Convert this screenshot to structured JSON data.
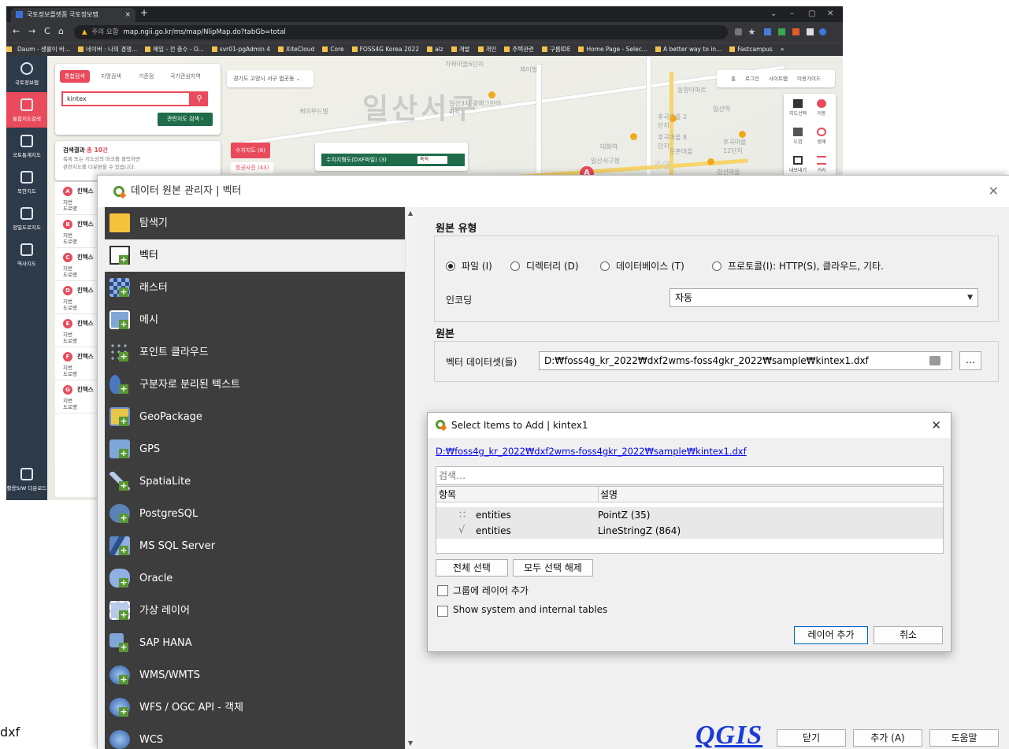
{
  "browser": {
    "tab_title": "국토정보플랫폼 국토정보맵",
    "tab_close": "×",
    "new_tab": "+",
    "window_controls": [
      "⌄",
      "–",
      "▢",
      "✕"
    ],
    "nav": [
      "←",
      "→",
      "C",
      "⌂"
    ],
    "security_icon": "▲",
    "security_text": "주의 요함",
    "url": "map.ngii.go.kr/ms/map/NlipMap.do?tabGb=total",
    "bookmarks": [
      "Daum - 생활이 바...",
      "네이버 : 나의 경쟁...",
      "메일 - 전 충수 - O...",
      "svr01-pgAdmin 4",
      "XiteCloud",
      "Core",
      "FOSS4G Korea 2022",
      "alz",
      "개발",
      "개인",
      "주택관련",
      "구름IDE",
      "Home Page - Selec...",
      "A better way to in...",
      "Fastcampus",
      "»"
    ]
  },
  "portal": {
    "nav": [
      {
        "label": "국토정보맵"
      },
      {
        "label": "통합지도검색"
      },
      {
        "label": "국토통계지도"
      },
      {
        "label": "북한지도"
      },
      {
        "label": "정밀도로지도"
      },
      {
        "label": "역사지도"
      },
      {
        "label": "활용S/W 다운로드"
      }
    ],
    "search_tabs": [
      "통합검색",
      "지명검색",
      "기준점",
      "국가관심지역"
    ],
    "search_value": "kintex",
    "related_btn": "관련지도 검색 ›",
    "region_select": "경기도 고양시 서구 법곳동 ⌄",
    "result_title": "검색결과",
    "result_count": "총 10건",
    "result_sub1": "목록 또는 지도상의 마크를 클릭하면",
    "result_sub2": "관련지도를 다운받을 수 있습니다.",
    "chip1": "수치지도 (6)",
    "chip2": "항공사진 (43)",
    "layer_title": "수치지형도(DXF파일) (3)",
    "layer_sel": "축척",
    "top_menu": "홈 로그인 사이트맵 이용가이드",
    "results": [
      {
        "pin": "A",
        "name": "킨텍스",
        "l1": "지번",
        "l2": "도로명"
      },
      {
        "pin": "B",
        "name": "킨텍스",
        "l1": "지번",
        "l2": "도로명"
      },
      {
        "pin": "C",
        "name": "킨텍스",
        "l1": "지번",
        "l2": "도로명"
      },
      {
        "pin": "D",
        "name": "킨텍스",
        "l1": "지번",
        "l2": "도로명"
      },
      {
        "pin": "E",
        "name": "킨텍스",
        "l1": "지번",
        "l2": "도로명"
      },
      {
        "pin": "F",
        "name": "킨텍스",
        "l1": "지번",
        "l2": "도로명"
      },
      {
        "pin": "G",
        "name": "킨텍스",
        "l1": "지번",
        "l2": "도로명"
      }
    ],
    "map_labels": [
      "일산서구",
      "케이우드빌",
      "일산역",
      "후곡마을 2단지",
      "후곡마을 8단지",
      "후곡마을 12단지",
      "대화역",
      "일산서구청",
      "주엽",
      "가좌마을6단지",
      "제이빌",
      "동양아파트",
      "일산3차 광해그린아파트",
      "강선마을",
      "문촌마을"
    ],
    "tools": [
      "지도선택",
      "이동",
      "도엽",
      "범례",
      "내보내기",
      "거리"
    ]
  },
  "qgis": {
    "title": "데이터 원본 관리자 | 벡터",
    "close": "✕",
    "sidebar": [
      {
        "label": "탐색기"
      },
      {
        "label": "벡터"
      },
      {
        "label": "래스터"
      },
      {
        "label": "메시"
      },
      {
        "label": "포인트 클라우드"
      },
      {
        "label": "구분자로 분리된 텍스트"
      },
      {
        "label": "GeoPackage"
      },
      {
        "label": "GPS"
      },
      {
        "label": "SpatiaLite"
      },
      {
        "label": "PostgreSQL"
      },
      {
        "label": "MS SQL Server"
      },
      {
        "label": "Oracle"
      },
      {
        "label": "가상 레이어"
      },
      {
        "label": "SAP HANA"
      },
      {
        "label": "WMS/WMTS"
      },
      {
        "label": "WFS / OGC API - 객체"
      },
      {
        "label": "WCS"
      }
    ],
    "source_type_title": "원본 유형",
    "radios": [
      "파일 (I)",
      "디렉터리 (D)",
      "데이터베이스 (T)",
      "프로토콜(I): HTTP(S), 클라우드, 기타."
    ],
    "encoding_label": "인코딩",
    "encoding_value": "자동",
    "source_title": "원본",
    "dataset_label": "벡터 데이터셋(들)",
    "dataset_value": "D:₩foss4g_kr_2022₩dxf2wms-foss4gkr_2022₩sample₩kintex1.dxf",
    "browse": "…",
    "buttons": {
      "close": "닫기",
      "add": "추가 (A)",
      "help": "도움말"
    },
    "logo": "QGIS"
  },
  "select_items": {
    "title": "Select Items to Add | kintex1",
    "close": "✕",
    "path": "D:₩foss4g_kr_2022₩dxf2wms-foss4gkr_2022₩sample₩kintex1.dxf",
    "search_placeholder": "검색…",
    "col_item": "항목",
    "col_desc": "설명",
    "rows": [
      {
        "item": "entities",
        "desc": "PointZ (35)",
        "icon": "point-icon"
      },
      {
        "item": "entities",
        "desc": "LineStringZ (864)",
        "icon": "line-icon"
      }
    ],
    "select_all": "전체 선택",
    "deselect_all": "모두 선택 해제",
    "group_label": "그룹에 레이어 추가",
    "system_label": "Show system and internal tables",
    "add_btn": "레이어 추가",
    "cancel_btn": "취소"
  },
  "background_text": "dxf"
}
